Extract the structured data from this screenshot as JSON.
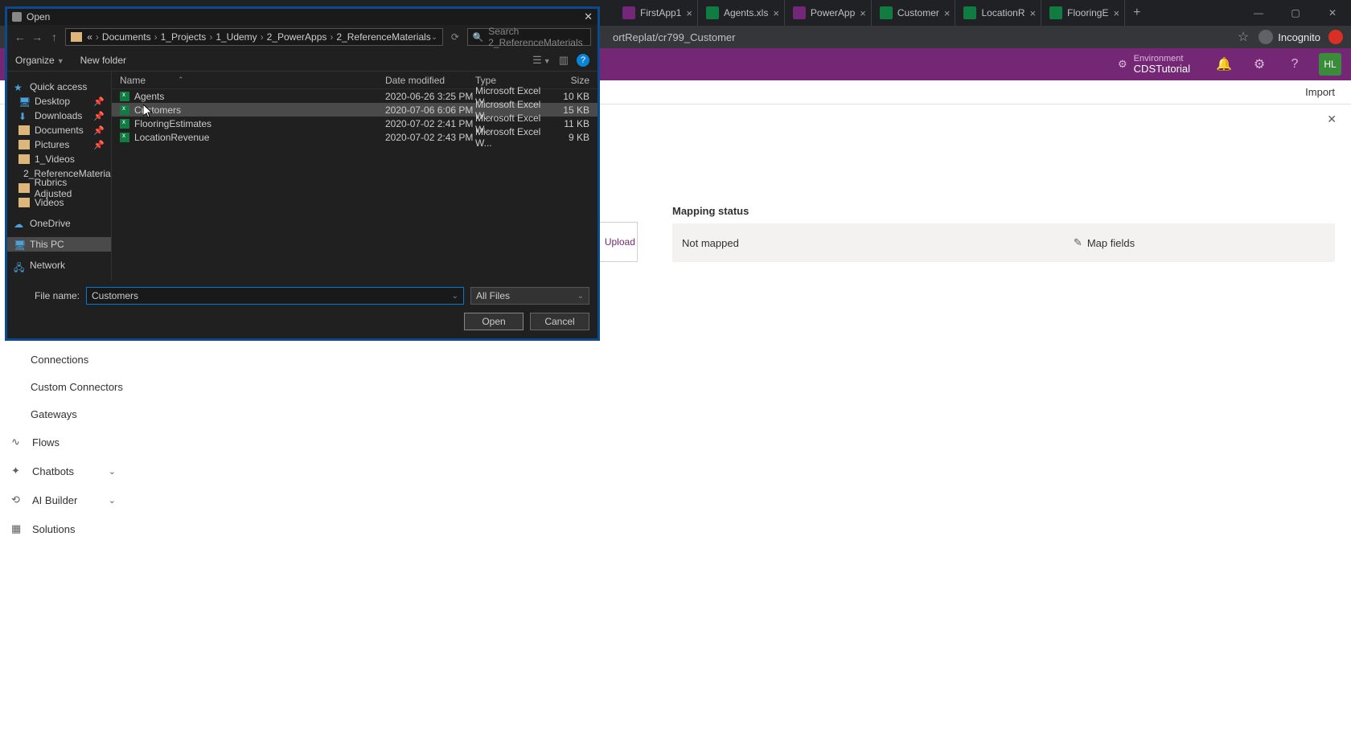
{
  "browser": {
    "tabs": [
      {
        "icon": "pa",
        "title": "FirstApp1"
      },
      {
        "icon": "xl",
        "title": "Agents.xls"
      },
      {
        "icon": "pa",
        "title": "PowerApp"
      },
      {
        "icon": "xl",
        "title": "Customer"
      },
      {
        "icon": "xl",
        "title": "LocationR"
      },
      {
        "icon": "xl",
        "title": "FlooringE"
      }
    ],
    "url": "ortReplat/cr799_Customer",
    "incognito": "Incognito"
  },
  "header": {
    "env_label": "Environment",
    "env_name": "CDSTutorial",
    "avatar": "HL"
  },
  "subbar": {
    "import": "Import"
  },
  "sidebar": {
    "connections": "Connections",
    "customconn": "Custom Connectors",
    "gateways": "Gateways",
    "flows": "Flows",
    "chatbots": "Chatbots",
    "aibuilder": "AI Builder",
    "solutions": "Solutions"
  },
  "content": {
    "mapping_status": "Mapping status",
    "not_mapped": "Not mapped",
    "upload": "Upload",
    "map_fields": "Map fields"
  },
  "dialog": {
    "title": "Open",
    "breadcrumbs": [
      "Documents",
      "1_Projects",
      "1_Udemy",
      "2_PowerApps",
      "2_ReferenceMaterials"
    ],
    "search_placeholder": "Search 2_ReferenceMaterials",
    "organize": "Organize",
    "newfolder": "New folder",
    "nav": {
      "quick": "Quick access",
      "desktop": "Desktop",
      "downloads": "Downloads",
      "documents": "Documents",
      "pictures": "Pictures",
      "videos1": "1_Videos",
      "refmat": "2_ReferenceMateria",
      "rubrics": "Rubrics Adjusted",
      "videos": "Videos",
      "onedrive": "OneDrive",
      "thispc": "This PC",
      "network": "Network"
    },
    "columns": {
      "name": "Name",
      "date": "Date modified",
      "type": "Type",
      "size": "Size"
    },
    "files": [
      {
        "name": "Agents",
        "date": "2020-06-26 3:25 PM",
        "type": "Microsoft Excel W...",
        "size": "10 KB"
      },
      {
        "name": "Customers",
        "date": "2020-07-06 6:06 PM",
        "type": "Microsoft Excel W...",
        "size": "15 KB"
      },
      {
        "name": "FlooringEstimates",
        "date": "2020-07-02 2:41 PM",
        "type": "Microsoft Excel W...",
        "size": "11 KB"
      },
      {
        "name": "LocationRevenue",
        "date": "2020-07-02 2:43 PM",
        "type": "Microsoft Excel W...",
        "size": "9 KB"
      }
    ],
    "filename_label": "File name:",
    "filename_value": "Customers",
    "filter": "All Files",
    "open": "Open",
    "cancel": "Cancel"
  }
}
